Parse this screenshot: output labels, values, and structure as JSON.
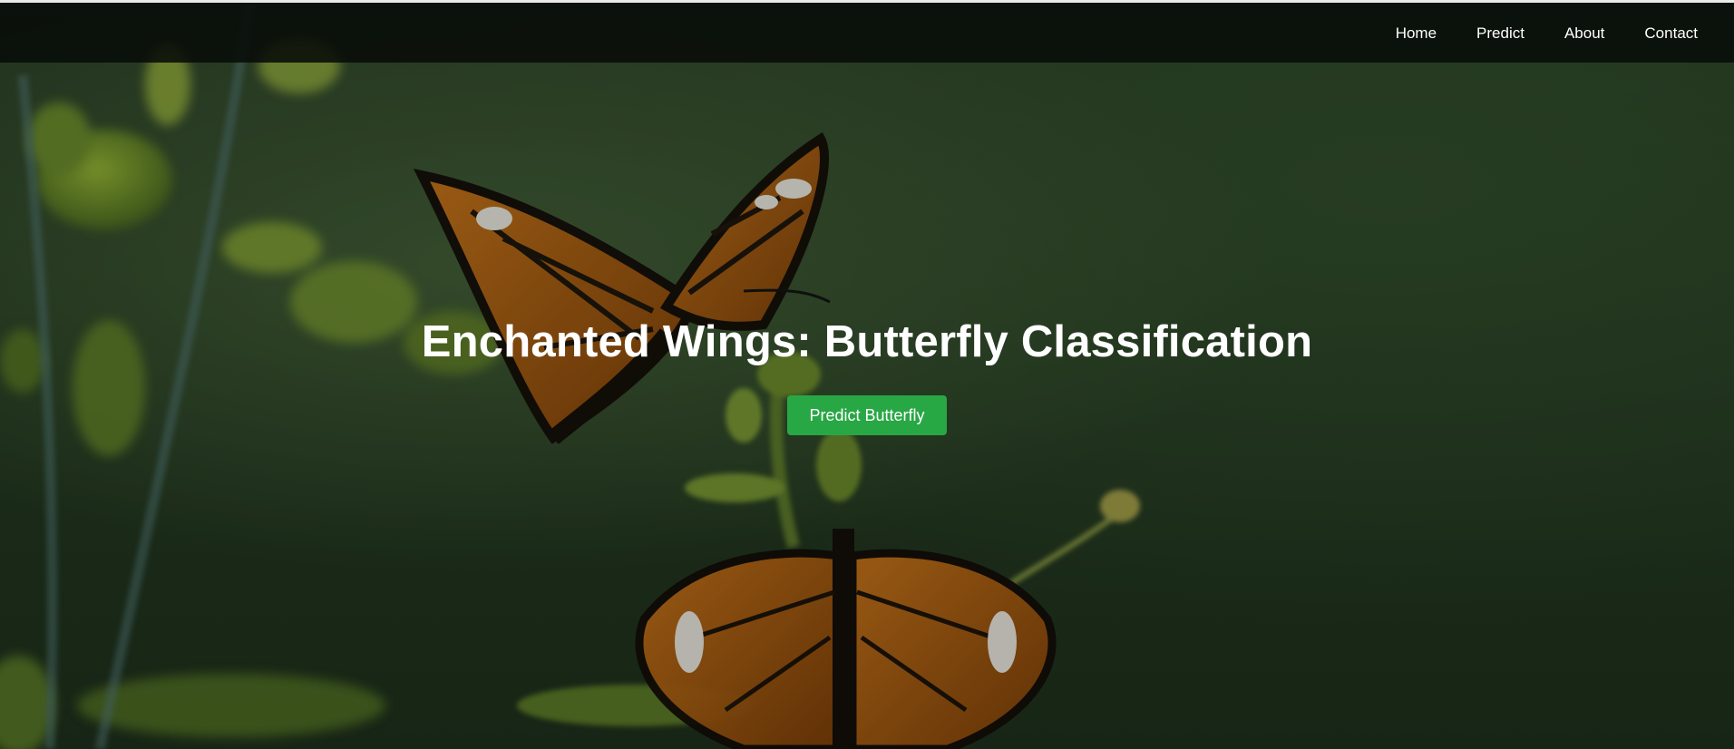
{
  "nav": {
    "items": [
      {
        "label": "Home"
      },
      {
        "label": "Predict"
      },
      {
        "label": "About"
      },
      {
        "label": "Contact"
      }
    ]
  },
  "hero": {
    "title": "Enchanted Wings: Butterfly Classification",
    "button_label": "Predict Butterfly",
    "background_image": "butterfly-photo"
  },
  "colors": {
    "navbar": "#080c08",
    "button": "#28a745",
    "text": "#ffffff"
  }
}
